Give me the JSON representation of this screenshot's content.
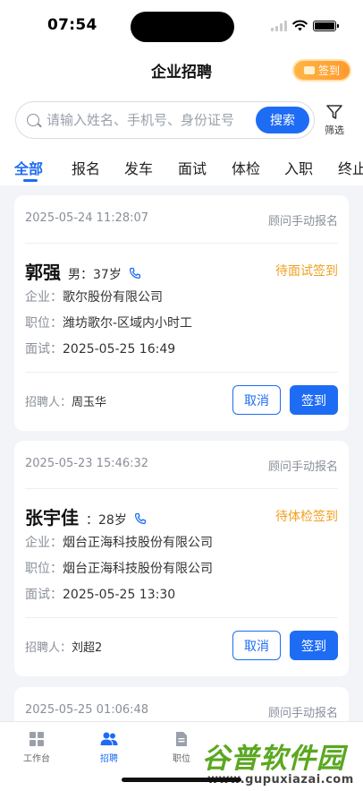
{
  "status": {
    "time": "07:54"
  },
  "header": {
    "title": "企业招聘",
    "signin_label": "签到"
  },
  "search": {
    "placeholder": "请输入姓名、手机号、身份证号",
    "button": "搜索",
    "filter_label": "筛选"
  },
  "tabs": [
    "全部",
    "报名",
    "发车",
    "面试",
    "体检",
    "入职",
    "终止"
  ],
  "active_tab": "全部",
  "cards": [
    {
      "time": "2025-05-24 11:28:07",
      "source": "顾问手动报名",
      "name": "郭强",
      "meta": "男：37岁",
      "state": "待面试签到",
      "company_label": "企业：",
      "company": "歌尔股份有限公司",
      "position_label": "职位：",
      "position": "潍坊歌尔-区域内小时工",
      "interview_label": "面试：",
      "interview": "2025-05-25 16:49",
      "recruiter_label": "招聘人：",
      "recruiter": "周玉华",
      "cancel": "取消",
      "sign": "签到"
    },
    {
      "time": "2025-05-23 15:46:32",
      "source": "顾问手动报名",
      "name": "张宇佳",
      "meta": "：28岁",
      "state": "待体检签到",
      "company_label": "企业：",
      "company": "烟台正海科技股份有限公司",
      "position_label": "职位：",
      "position": "烟台正海科技股份有限公司",
      "interview_label": "面试：",
      "interview": "2025-05-25 13:30",
      "recruiter_label": "招聘人：",
      "recruiter": "刘超2",
      "cancel": "取消",
      "sign": "签到"
    },
    {
      "time": "2025-05-25 01:06:48",
      "source": "顾问手动报名"
    }
  ],
  "tabbar": [
    {
      "label": "工作台",
      "icon": "grid-icon"
    },
    {
      "label": "招聘",
      "icon": "people-icon"
    },
    {
      "label": "职位",
      "icon": "document-icon"
    }
  ],
  "watermark": {
    "title": "谷普软件园",
    "url": "www.gupuxiazai.com"
  },
  "colors": {
    "accent": "#1e6cf4",
    "warning": "#f0a020",
    "signin": "#ff9a2e",
    "watermark": "#5aa820"
  }
}
